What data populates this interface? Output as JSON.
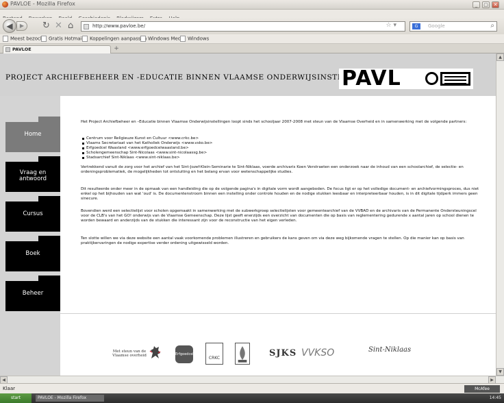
{
  "browser": {
    "window_title": "PAVLOE - Mozilla Firefox",
    "menu": [
      "Bestand",
      "Bewerken",
      "Beeld",
      "Geschiedenis",
      "Bladwijzers",
      "Extra",
      "Help"
    ],
    "url": "http://www.pavloe.be/",
    "search_placeholder": "Google",
    "bookmarks": [
      "Meest bezocht",
      "Gratis Hotmail",
      "Koppelingen aanpassen",
      "Windows Media",
      "Windows"
    ],
    "tab_title": "PAVLOE",
    "status_text": "Klaar",
    "addon_label": "McAfee SiteAdvisor",
    "taskbar_item": "PAVLOE - Mozilla Firefox",
    "clock": "14:45"
  },
  "page": {
    "banner_title": "PROJECT ARCHIEFBEHEER EN -EDUCATIE BINNEN VLAAMSE ONDERWIJSINSTELLINGEN",
    "logo_text": "PAVL",
    "nav": [
      "Home",
      "Vraag en antwoord",
      "Cursus",
      "Boek",
      "Beheer"
    ],
    "intro": "Het Project Archiefbeheer en –Educatie binnen Vlaamse Onderwijsinstellingen loopt sinds het schooljaar 2007-2008 met steun van de Vlaamse Overheid en in samenwerking met de volgende partners:",
    "partners": [
      "Centrum voor Religieuze Kunst en Cultuur <www.crkc.be>",
      "Vlaams Secretariaat van het Katholiek Onderwijs <www.vsko.be>",
      "Erfgoedcel Waasland <www.erfgoedcelwaasland.be>",
      "Scholengemeenschap Sint-Nicolaas <www.sint-nicolaassg.be>",
      "Stadsarchief Sint-Niklaas <www.sint-niklaas.be>"
    ],
    "paragraphs": [
      "Vertrekkend vanuit de zorg voor het archief van het Sint-Jozef-Klein-Seminarie te Sint-Niklaas, voerde archivaris Koen Verstraeten een onderzoek naar de inhoud van een schoolarchief, de selectie- en ordeningsproblematiek, de mogelijkheden tot ontsluiting en het belang ervan voor wetenschappelijke studies.",
      "Dit resulteerde onder meer in de opmaak van een handleiding die op de volgende pagina's in digitale vorm wordt aangeboden. De focus ligt er op het volledige document- en archiefvormingsproces, dus niet enkel op het bijhouden van wat 'oud' is. De documentenstroom binnen een instelling onder controle houden en de nodige stukken leesbaar en interpreteerbaar houden, is in dit digitale tijdperk immers geen sinecure.",
      "Bovendien werd een selectielijst voor scholen opgemaakt in samenwerking met de subwerkgroep selectielijsten voor gemeentearchief van de VVBAD en de archivaris van de Permanente Ondersteuningscel voor de CLB's van het GO! onderwijs van de Vlaamse Gemeenschap. Deze lijst geeft enerzijds een overzicht van documenten die op basis van reglementering gedurende x aantal jaren op school dienen te worden bewaard en anderzijds van de stukken die interessant zijn voor de reconstructie van het eigen verleden.",
      "Ten slotte willen we via deze website een aantal vaak voorkomende problemen illustreren en gebruikers de kans geven om via deze weg bijkomende vragen te stellen. Op die manier kan op basis van praktijkervaringen de nodige expertise verder ordening uitgewisseld worden."
    ],
    "sponsors": {
      "vlaanderen": "Met steun van de Vlaamse overheid",
      "erfgoedcel": "Erfgoedcel",
      "crkc": "CRKC",
      "sjks": "SJKS",
      "vvkso": "VVKSO",
      "sint_niklaas": "Sint-Niklaas"
    }
  },
  "colors": {
    "nav_active": "#7b7b7b",
    "nav_default": "#000000",
    "banner_bg": "#d2d2d2"
  },
  "icons": {
    "back": "back-arrow-icon",
    "reload": "reload-icon",
    "stop": "stop-icon",
    "home": "home-icon"
  }
}
